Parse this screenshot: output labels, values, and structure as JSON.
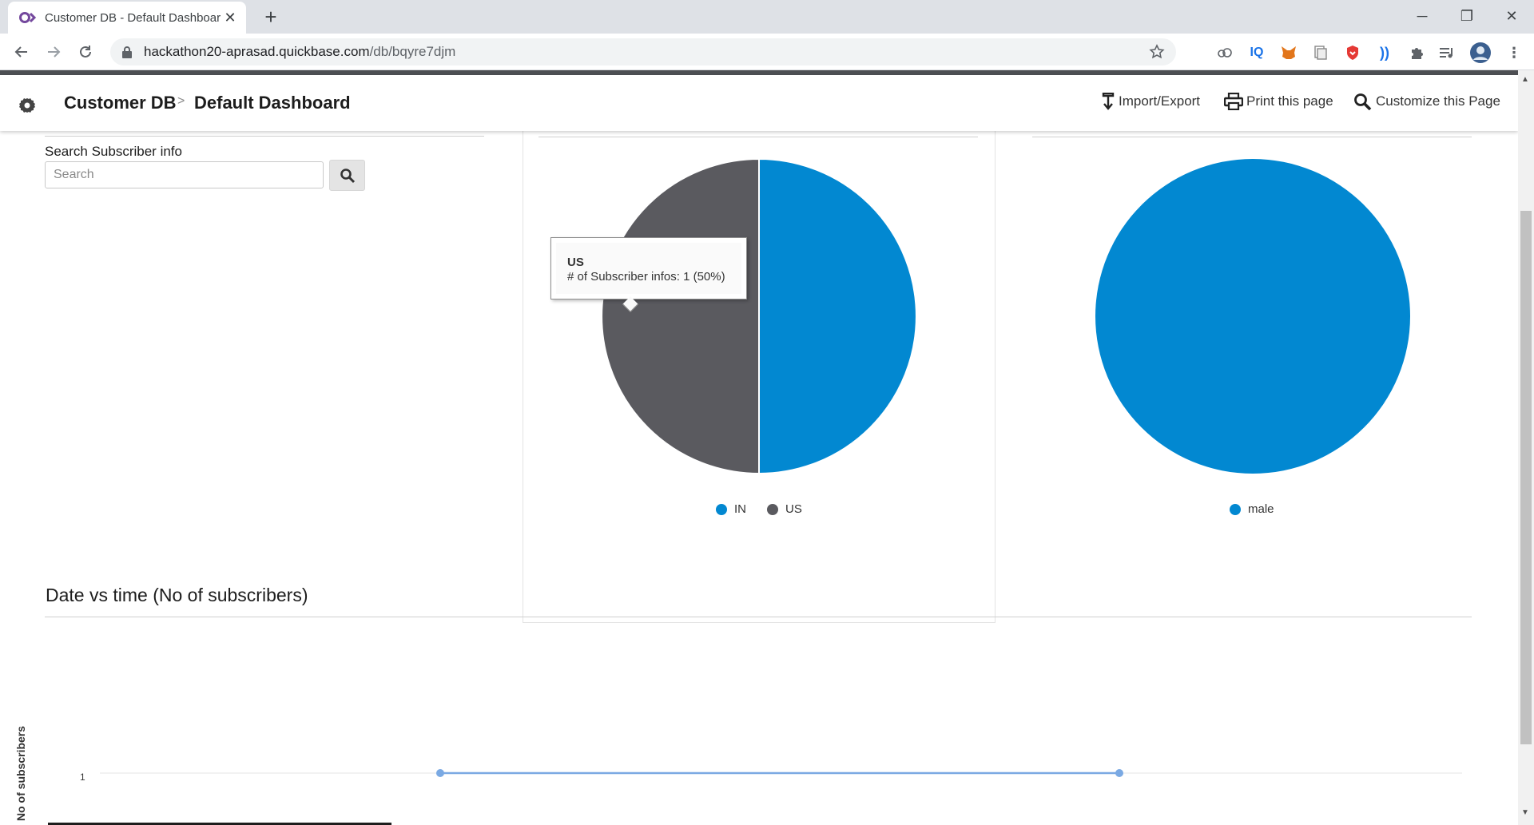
{
  "browser": {
    "tab_title": "Customer DB - Default Dashboar",
    "new_tab": "+",
    "url_host": "hackathon20-aprasad.quickbase.com",
    "url_path": "/db/bqyre7djm"
  },
  "header": {
    "app_name": "Customer DB",
    "separator": ">",
    "page_name": "Default Dashboard",
    "actions": {
      "import_export": "Import/Export",
      "print": "Print this page",
      "customize": "Customize this Page"
    }
  },
  "search": {
    "label": "Search Subscriber info",
    "placeholder": "Search"
  },
  "tooltip": {
    "title": "US",
    "value": "# of Subscriber infos: 1 (50%)"
  },
  "line_chart": {
    "title": "Date vs time (No of subscribers)"
  },
  "colors": {
    "blue": "#0288d1",
    "dark_grey": "#5a5a5f",
    "line": "#7aa9e3",
    "quickbase_purple": "#74489d"
  },
  "chart_data": [
    {
      "type": "pie",
      "labels": [
        "IN",
        "US"
      ],
      "values": [
        1,
        1
      ],
      "colors": [
        "#0288d1",
        "#5a5a5f"
      ],
      "legend_position": "bottom"
    },
    {
      "type": "pie",
      "labels": [
        "male"
      ],
      "values": [
        1
      ],
      "colors": [
        "#0288d1"
      ],
      "legend_position": "bottom"
    },
    {
      "type": "line",
      "title": "Date vs time (No of subscribers)",
      "ylabel": "No of subscribers",
      "y_ticks": [
        "1"
      ],
      "series": [
        {
          "values": [
            1,
            1
          ]
        }
      ],
      "grid": true
    }
  ]
}
